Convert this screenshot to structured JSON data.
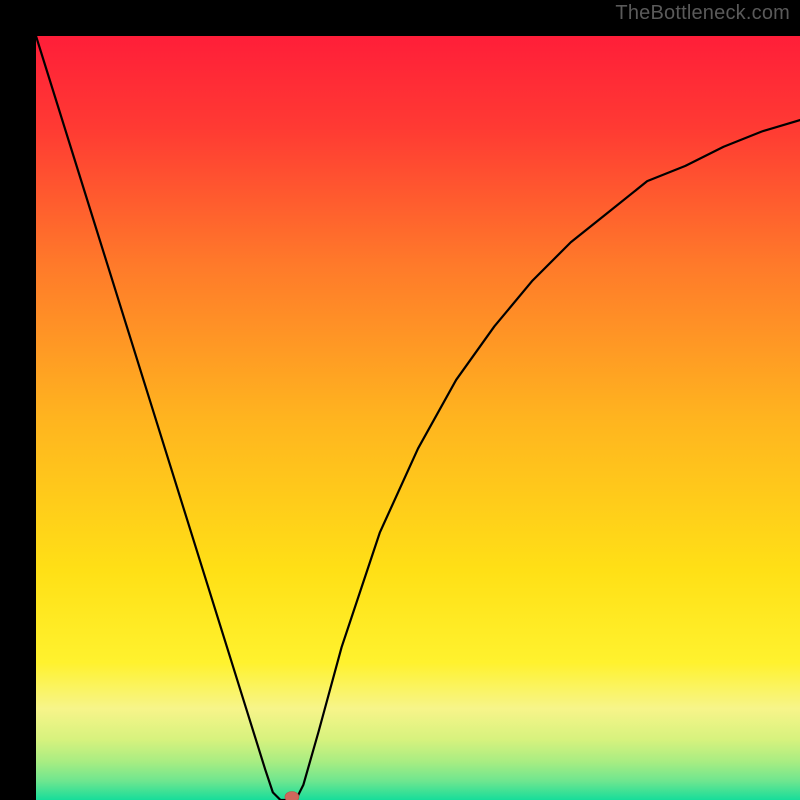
{
  "watermark": "TheBottleneck.com",
  "chart_data": {
    "type": "line",
    "title": "",
    "xlabel": "",
    "ylabel": "",
    "xlim": [
      0,
      100
    ],
    "ylim": [
      0,
      100
    ],
    "grid": false,
    "legend": false,
    "background_gradient": {
      "top_color": "#ff1e39",
      "mid_color": "#ffd400",
      "bottom_colors": [
        "#f7f58a",
        "#c9ef7c",
        "#6fe68f",
        "#17dd9a"
      ]
    },
    "series": [
      {
        "name": "bottleneck-curve",
        "x": [
          0,
          2.5,
          5,
          7.5,
          10,
          12.5,
          15,
          17.5,
          20,
          22.5,
          25,
          27.5,
          30,
          31,
          32,
          33,
          34,
          35,
          37,
          40,
          45,
          50,
          55,
          60,
          65,
          70,
          75,
          80,
          85,
          90,
          95,
          100
        ],
        "y": [
          100,
          92,
          84,
          76,
          68,
          60,
          52,
          44,
          36,
          28,
          20,
          12,
          4,
          1,
          0,
          0,
          0,
          2,
          9,
          20,
          35,
          46,
          55,
          62,
          68,
          73,
          77,
          81,
          83,
          85.5,
          87.5,
          89
        ]
      }
    ],
    "marker": {
      "name": "optimal-point",
      "x": 33.5,
      "y": 0,
      "color": "#d0665c"
    }
  }
}
